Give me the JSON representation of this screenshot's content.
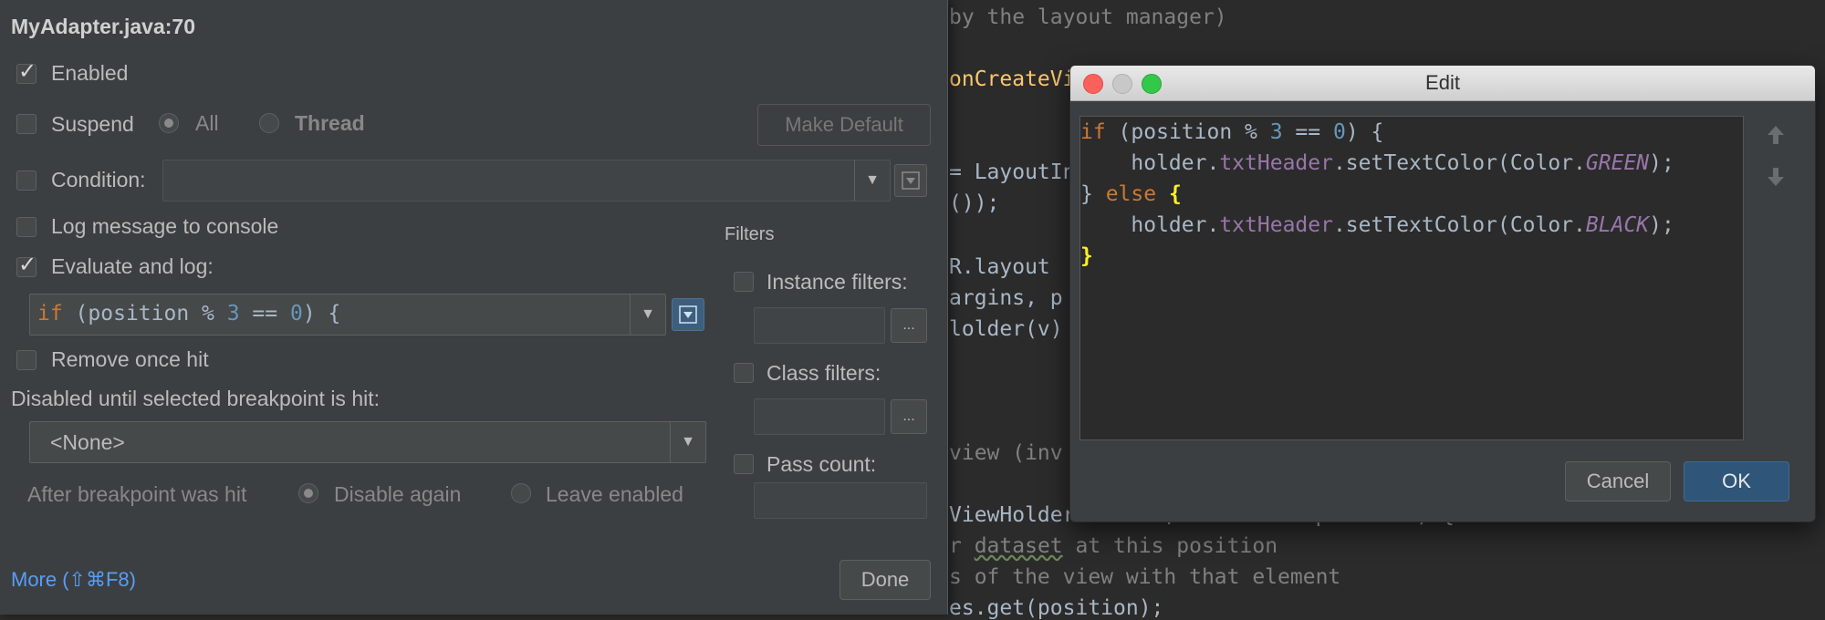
{
  "editor_code": {
    "line1": "by the layout manager)",
    "line2": "onCreateVi",
    "line3a": "= LayoutIn",
    "line3b": "()); ",
    "line4": "R.layout",
    "line5": "argins, p",
    "line6": "lolder(v)",
    "line7": "view (inv",
    "line8": "ViewHolder holder, final int position) {",
    "line9_prefix": "r ",
    "line9_link": "dataset",
    "line9_suffix": " at this position",
    "line10": "s of the view with that element",
    "line11": "es.get(position);"
  },
  "breakpoint": {
    "title": "MyAdapter.java:70",
    "enabled_label": "Enabled",
    "suspend_label": "Suspend",
    "all_label": "All",
    "thread_label": "Thread",
    "make_default_label": "Make Default",
    "condition_label": "Condition:",
    "log_message_label": "Log message to console",
    "evaluate_label": "Evaluate and log:",
    "expression": {
      "kw": "if",
      "pre": " (position % ",
      "num1": "3",
      "mid": " == ",
      "num2": "0",
      "post": ") {"
    },
    "remove_once_label": "Remove once hit",
    "disabled_until_label": "Disabled until selected breakpoint is hit:",
    "none_option": "<None>",
    "after_hit_label": "After breakpoint was hit",
    "disable_again_label": "Disable again",
    "leave_enabled_label": "Leave enabled",
    "filters_title": "Filters",
    "instance_filters_label": "Instance filters:",
    "class_filters_label": "Class filters:",
    "pass_count_label": "Pass count:",
    "ellipsis": "...",
    "more_label": "More (⇧⌘F8)",
    "done_label": "Done"
  },
  "edit_dialog": {
    "title": "Edit",
    "code": {
      "l1_kw": "if",
      "l1_a": " (position % ",
      "l1_num1": "3",
      "l1_b": " == ",
      "l1_num2": "0",
      "l1_c": ") {",
      "l2_a": "    holder.",
      "l2_field": "txtHeader",
      "l2_b": ".setTextColor(Color.",
      "l2_const": "GREEN",
      "l2_c": ");",
      "l3_a": "} ",
      "l3_kw": "else",
      "l3_brace": " {",
      "l4_a": "    holder.",
      "l4_field": "txtHeader",
      "l4_b": ".setTextColor(Color.",
      "l4_const": "BLACK",
      "l4_c": ");",
      "l5_brace": "}"
    },
    "cancel_label": "Cancel",
    "ok_label": "OK"
  },
  "colors": {
    "popup_bg": "#3c3f41",
    "editor_bg": "#2b2b2b",
    "keyword": "#cc7832",
    "number": "#6897bb",
    "field": "#9876aa",
    "link": "#589df6",
    "ok_button": "#2f5579"
  },
  "icons": [
    "check-icon",
    "dropdown-arrow-icon",
    "expand-editor-icon",
    "ellipsis-icon",
    "arrow-up-icon",
    "arrow-down-icon"
  ]
}
